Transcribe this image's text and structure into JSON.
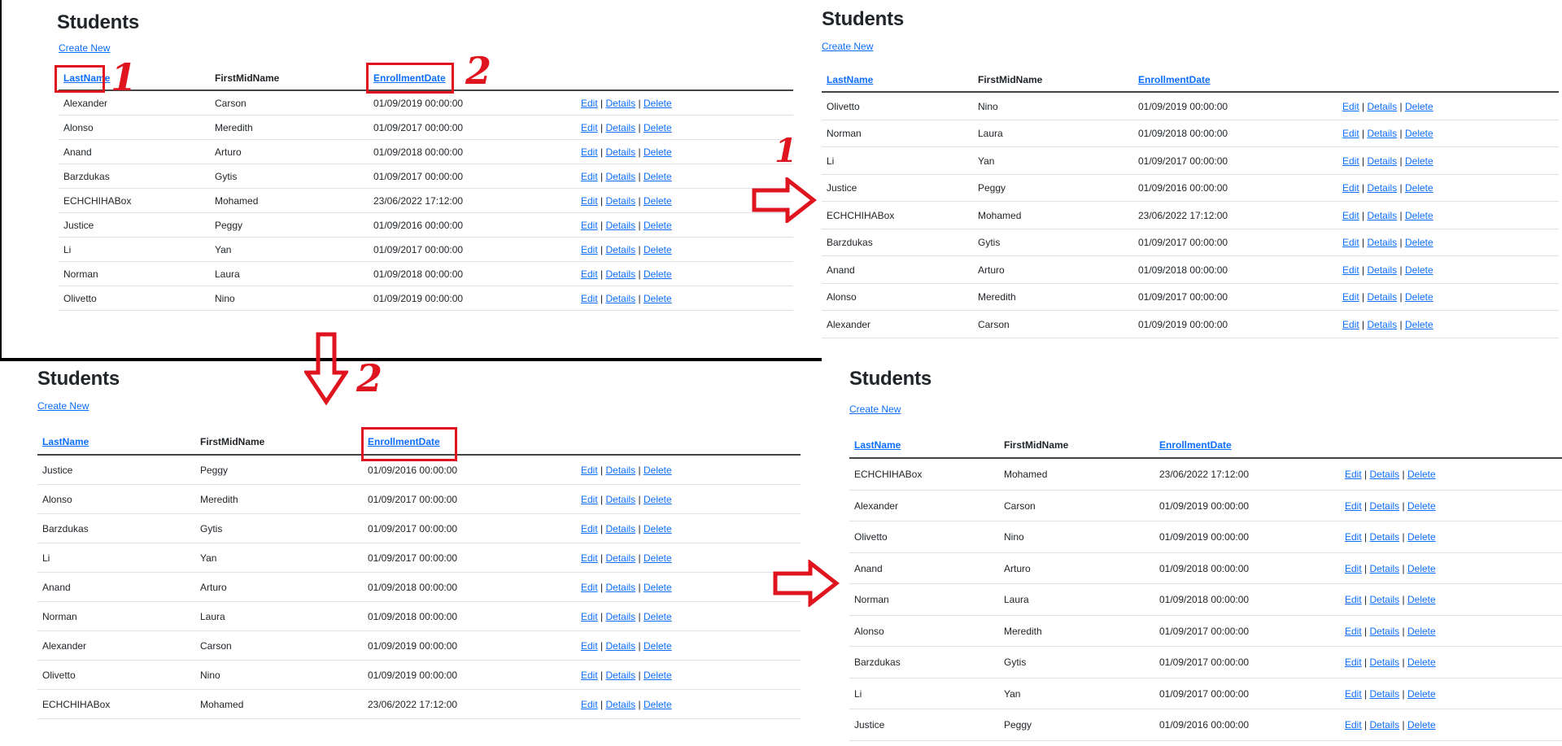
{
  "panels": [
    {
      "id": "p1",
      "title": "Students",
      "create_new": "Create New",
      "headers": {
        "last": "LastName",
        "first": "FirstMidName",
        "date": "EnrollmentDate"
      },
      "actions": {
        "edit": "Edit",
        "details": "Details",
        "delete": "Delete",
        "sep": "|"
      },
      "rows": [
        {
          "last": "Alexander",
          "first": "Carson",
          "date": "01/09/2019 00:00:00"
        },
        {
          "last": "Alonso",
          "first": "Meredith",
          "date": "01/09/2017 00:00:00"
        },
        {
          "last": "Anand",
          "first": "Arturo",
          "date": "01/09/2018 00:00:00"
        },
        {
          "last": "Barzdukas",
          "first": "Gytis",
          "date": "01/09/2017 00:00:00"
        },
        {
          "last": "ECHCHIHABox",
          "first": "Mohamed",
          "date": "23/06/2022 17:12:00"
        },
        {
          "last": "Justice",
          "first": "Peggy",
          "date": "01/09/2016 00:00:00"
        },
        {
          "last": "Li",
          "first": "Yan",
          "date": "01/09/2017 00:00:00"
        },
        {
          "last": "Norman",
          "first": "Laura",
          "date": "01/09/2018 00:00:00"
        },
        {
          "last": "Olivetto",
          "first": "Nino",
          "date": "01/09/2019 00:00:00"
        }
      ]
    },
    {
      "id": "p2",
      "title": "Students",
      "create_new": "Create New",
      "headers": {
        "last": "LastName",
        "first": "FirstMidName",
        "date": "EnrollmentDate"
      },
      "actions": {
        "edit": "Edit",
        "details": "Details",
        "delete": "Delete",
        "sep": "|"
      },
      "rows": [
        {
          "last": "Olivetto",
          "first": "Nino",
          "date": "01/09/2019 00:00:00"
        },
        {
          "last": "Norman",
          "first": "Laura",
          "date": "01/09/2018 00:00:00"
        },
        {
          "last": "Li",
          "first": "Yan",
          "date": "01/09/2017 00:00:00"
        },
        {
          "last": "Justice",
          "first": "Peggy",
          "date": "01/09/2016 00:00:00"
        },
        {
          "last": "ECHCHIHABox",
          "first": "Mohamed",
          "date": "23/06/2022 17:12:00"
        },
        {
          "last": "Barzdukas",
          "first": "Gytis",
          "date": "01/09/2017 00:00:00"
        },
        {
          "last": "Anand",
          "first": "Arturo",
          "date": "01/09/2018 00:00:00"
        },
        {
          "last": "Alonso",
          "first": "Meredith",
          "date": "01/09/2017 00:00:00"
        },
        {
          "last": "Alexander",
          "first": "Carson",
          "date": "01/09/2019 00:00:00"
        }
      ]
    },
    {
      "id": "p3",
      "title": "Students",
      "create_new": "Create New",
      "headers": {
        "last": "LastName",
        "first": "FirstMidName",
        "date": "EnrollmentDate"
      },
      "actions": {
        "edit": "Edit",
        "details": "Details",
        "delete": "Delete",
        "sep": "|"
      },
      "rows": [
        {
          "last": "Justice",
          "first": "Peggy",
          "date": "01/09/2016 00:00:00"
        },
        {
          "last": "Alonso",
          "first": "Meredith",
          "date": "01/09/2017 00:00:00"
        },
        {
          "last": "Barzdukas",
          "first": "Gytis",
          "date": "01/09/2017 00:00:00"
        },
        {
          "last": "Li",
          "first": "Yan",
          "date": "01/09/2017 00:00:00"
        },
        {
          "last": "Anand",
          "first": "Arturo",
          "date": "01/09/2018 00:00:00"
        },
        {
          "last": "Norman",
          "first": "Laura",
          "date": "01/09/2018 00:00:00"
        },
        {
          "last": "Alexander",
          "first": "Carson",
          "date": "01/09/2019 00:00:00"
        },
        {
          "last": "Olivetto",
          "first": "Nino",
          "date": "01/09/2019 00:00:00"
        },
        {
          "last": "ECHCHIHABox",
          "first": "Mohamed",
          "date": "23/06/2022 17:12:00"
        }
      ]
    },
    {
      "id": "p4",
      "title": "Students",
      "create_new": "Create New",
      "headers": {
        "last": "LastName",
        "first": "FirstMidName",
        "date": "EnrollmentDate"
      },
      "actions": {
        "edit": "Edit",
        "details": "Details",
        "delete": "Delete",
        "sep": "|"
      },
      "rows": [
        {
          "last": "ECHCHIHABox",
          "first": "Mohamed",
          "date": "23/06/2022 17:12:00"
        },
        {
          "last": "Alexander",
          "first": "Carson",
          "date": "01/09/2019 00:00:00"
        },
        {
          "last": "Olivetto",
          "first": "Nino",
          "date": "01/09/2019 00:00:00"
        },
        {
          "last": "Anand",
          "first": "Arturo",
          "date": "01/09/2018 00:00:00"
        },
        {
          "last": "Norman",
          "first": "Laura",
          "date": "01/09/2018 00:00:00"
        },
        {
          "last": "Alonso",
          "first": "Meredith",
          "date": "01/09/2017 00:00:00"
        },
        {
          "last": "Barzdukas",
          "first": "Gytis",
          "date": "01/09/2017 00:00:00"
        },
        {
          "last": "Li",
          "first": "Yan",
          "date": "01/09/2017 00:00:00"
        },
        {
          "last": "Justice",
          "first": "Peggy",
          "date": "01/09/2016 00:00:00"
        }
      ]
    }
  ],
  "annotations": {
    "step1": "1",
    "step2": "2",
    "step1_arrow": "1",
    "step2_arrow": "2"
  },
  "colors": {
    "annotation": "#e0141e",
    "link": "#0d6efd"
  }
}
